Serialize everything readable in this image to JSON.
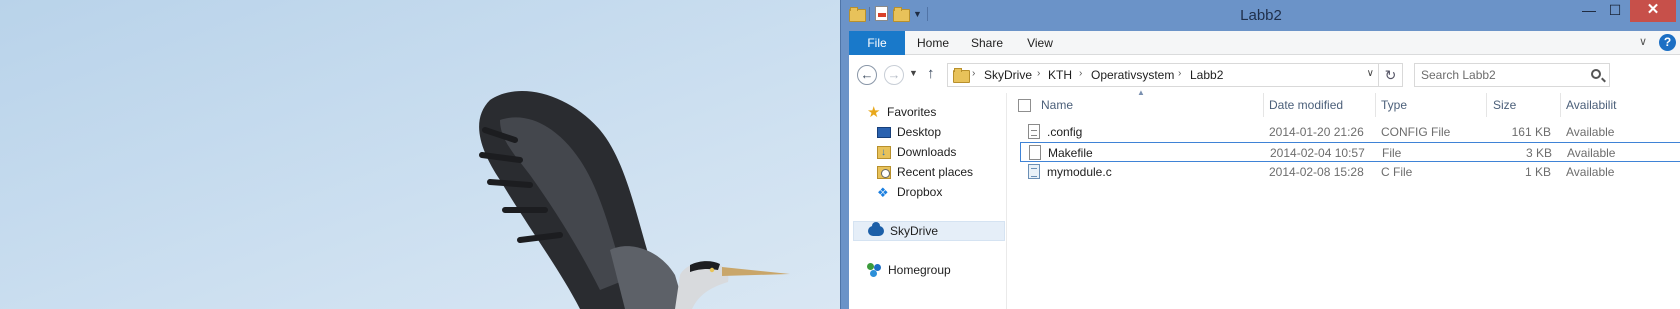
{
  "window": {
    "title": "Labb2",
    "controls": {
      "minimize": "—",
      "maximize": "☐",
      "close": "✕"
    }
  },
  "ribbon": {
    "tabs": [
      "File",
      "Home",
      "Share",
      "View"
    ],
    "help": "?"
  },
  "address": {
    "breadcrumbs": [
      "SkyDrive",
      "KTH",
      "Operativsystem",
      "Labb2"
    ],
    "separator": "›"
  },
  "search": {
    "placeholder": "Search Labb2"
  },
  "nav_pane": {
    "favorites": {
      "label": "Favorites",
      "items": [
        {
          "label": "Desktop",
          "icon": "desktop-icon"
        },
        {
          "label": "Downloads",
          "icon": "downloads-folder-icon"
        },
        {
          "label": "Recent places",
          "icon": "recent-places-icon"
        },
        {
          "label": "Dropbox",
          "icon": "dropbox-icon"
        }
      ]
    },
    "skydrive": {
      "label": "SkyDrive",
      "icon": "skydrive-cloud-icon"
    },
    "homegroup": {
      "label": "Homegroup",
      "icon": "homegroup-icon"
    }
  },
  "file_list": {
    "columns": [
      "Name",
      "Date modified",
      "Type",
      "Size",
      "Availabilit"
    ],
    "rows": [
      {
        "name": ".config",
        "date": "2014-01-20 21:26",
        "type": "CONFIG File",
        "size": "161 KB",
        "availability": "Available",
        "icon": "config-file-icon"
      },
      {
        "name": "Makefile",
        "date": "2014-02-04 10:57",
        "type": "File",
        "size": "3 KB",
        "availability": "Available",
        "icon": "blank-file-icon",
        "selected": true
      },
      {
        "name": "mymodule.c",
        "date": "2014-02-08 15:28",
        "type": "C File",
        "size": "1 KB",
        "availability": "Available",
        "icon": "c-file-icon"
      }
    ]
  },
  "colors": {
    "title_bar": "#6b93c8",
    "file_tab": "#1979ca",
    "close_button": "#c7504a",
    "selection_border": "#3f83d6",
    "nav_selected": "#e5eef8"
  }
}
